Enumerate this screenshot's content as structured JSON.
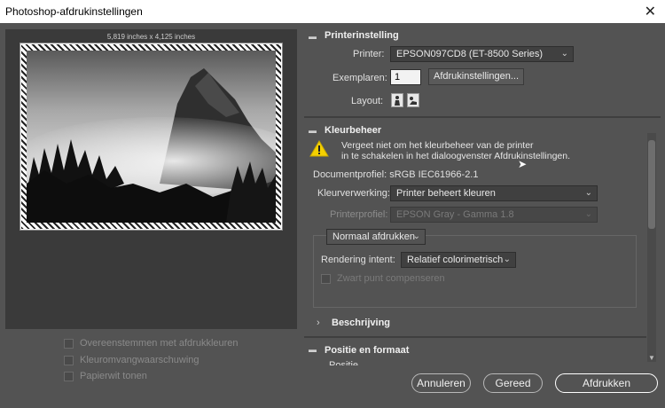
{
  "window": {
    "title": "Photoshop-afdrukinstellingen",
    "close_glyph": "✕"
  },
  "preview": {
    "dimensions": "5,819 inches x 4,125 inches"
  },
  "left_options": [
    {
      "label": "Overeenstemmen met afdrukkleuren"
    },
    {
      "label": "Kleuromvangwaarschuwing"
    },
    {
      "label": "Papierwit tonen"
    }
  ],
  "printer_section": {
    "title": "Printerinstelling",
    "printer_label": "Printer:",
    "printer_value": "EPSON097CD8 (ET-8500 Series)",
    "copies_label": "Exemplaren:",
    "copies_value": "1",
    "print_settings_button": "Afdrukinstellingen...",
    "layout_label": "Layout:"
  },
  "color_section": {
    "title": "Kleurbeheer",
    "warning_line1": "Vergeet niet om het kleurbeheer van de printer",
    "warning_line2": "in te schakelen in het dialoogvenster Afdrukinstellingen.",
    "doc_profile": "Documentprofiel: sRGB IEC61966-2.1",
    "color_handling_label": "Kleurverwerking:",
    "color_handling_value": "Printer beheert kleuren",
    "printer_profile_label": "Printerprofiel:",
    "printer_profile_value": "EPSON  Gray - Gamma 1.8",
    "mode_value": "Normaal afdrukken",
    "rendering_label": "Rendering intent:",
    "rendering_value": "Relatief colorimetrisch",
    "black_point_label": "Zwart punt compenseren"
  },
  "description_section": {
    "title": "Beschrijving"
  },
  "position_section": {
    "title": "Positie en formaat",
    "sub_label": "Positie"
  },
  "buttons": {
    "cancel": "Annuleren",
    "done": "Gereed",
    "print": "Afdrukken"
  },
  "colors": {
    "dialog_bg": "#535353",
    "panel_bg": "#3a3a3a",
    "warning": "#f5d000"
  }
}
